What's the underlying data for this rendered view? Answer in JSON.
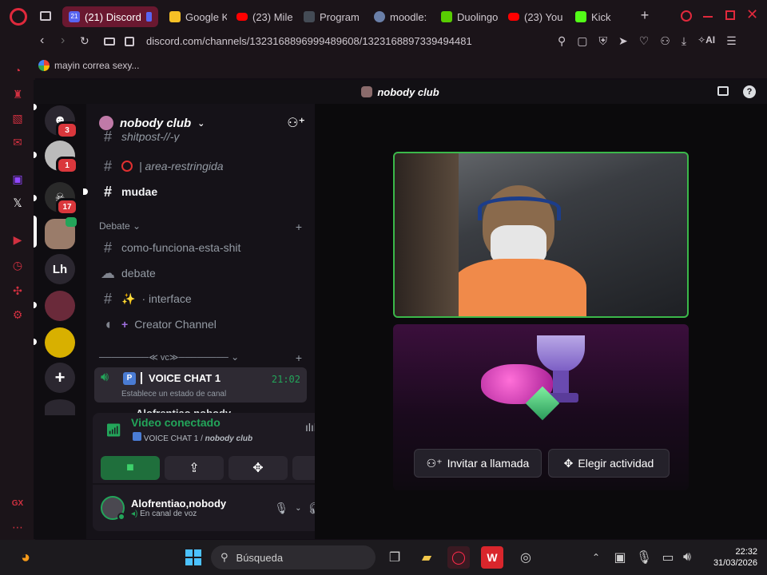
{
  "browser": {
    "tabs": [
      {
        "label": "(21) Discord",
        "badge": "21",
        "active": true,
        "color": "#5865f2"
      },
      {
        "label": "Google K",
        "color": "#f6c026"
      },
      {
        "label": "(23) Mile",
        "color": "#ff0000"
      },
      {
        "label": "Program",
        "color": "#444b55"
      },
      {
        "label": "moodle:",
        "color": "#6a7fa8"
      },
      {
        "label": "Duolingo",
        "color": "#58cc02"
      },
      {
        "label": "(23) You",
        "color": "#ff0000"
      },
      {
        "label": "Kick",
        "color": "#53fc18"
      }
    ],
    "url": "discord.com/channels/1323168896999489608/1323168897339494481",
    "bookmark": "mayin correa sexy...",
    "ai_label": "AI"
  },
  "discord": {
    "top_title": "nobody club",
    "guilds": [
      {
        "kind": "dm",
        "badge": "3"
      },
      {
        "kind": "avatar",
        "badge": "1",
        "color": "#bbbbbb"
      },
      {
        "kind": "avatar",
        "badge": "17",
        "color": "#555555"
      },
      {
        "kind": "avatar",
        "color": "#9a7c6a"
      },
      {
        "kind": "text",
        "label": "Lh"
      },
      {
        "kind": "avatar",
        "color": "#6a2a3a"
      },
      {
        "kind": "avatar",
        "color": "#d8b000"
      },
      {
        "kind": "add"
      }
    ],
    "server_name": "nobody club",
    "channels": {
      "cut_top": "shitpost-//-y",
      "area": "| area-restringida",
      "mudae": "mudae",
      "category_debate": "Debate",
      "como": "como-funciona-esta-shit",
      "debate": "debate",
      "interface": "· interface",
      "creator": "Creator Channel",
      "category_vc": "────────≪ vc≫────────",
      "voice_chat": "VOICE CHAT 1",
      "voice_time": "21:02",
      "voice_status": "Establece un estado de canal",
      "voice_user_cut": "Alofrentiao,nobody"
    },
    "voice": {
      "status": "Video conectado",
      "path_channel": "VOICE CHAT 1",
      "path_sep": " / ",
      "path_server": "nobody club"
    },
    "user": {
      "name": "Alofrentiao,nobody",
      "status": "En canal de voz"
    },
    "stage": {
      "invite": "Invitar a llamada",
      "activity": "Elegir actividad"
    },
    "colors": {
      "accent_green": "#23a55a",
      "video_border": "#3bb84a"
    }
  },
  "taskbar": {
    "search": "Búsqueda",
    "time": "22:32",
    "date": "31/03/2026"
  }
}
